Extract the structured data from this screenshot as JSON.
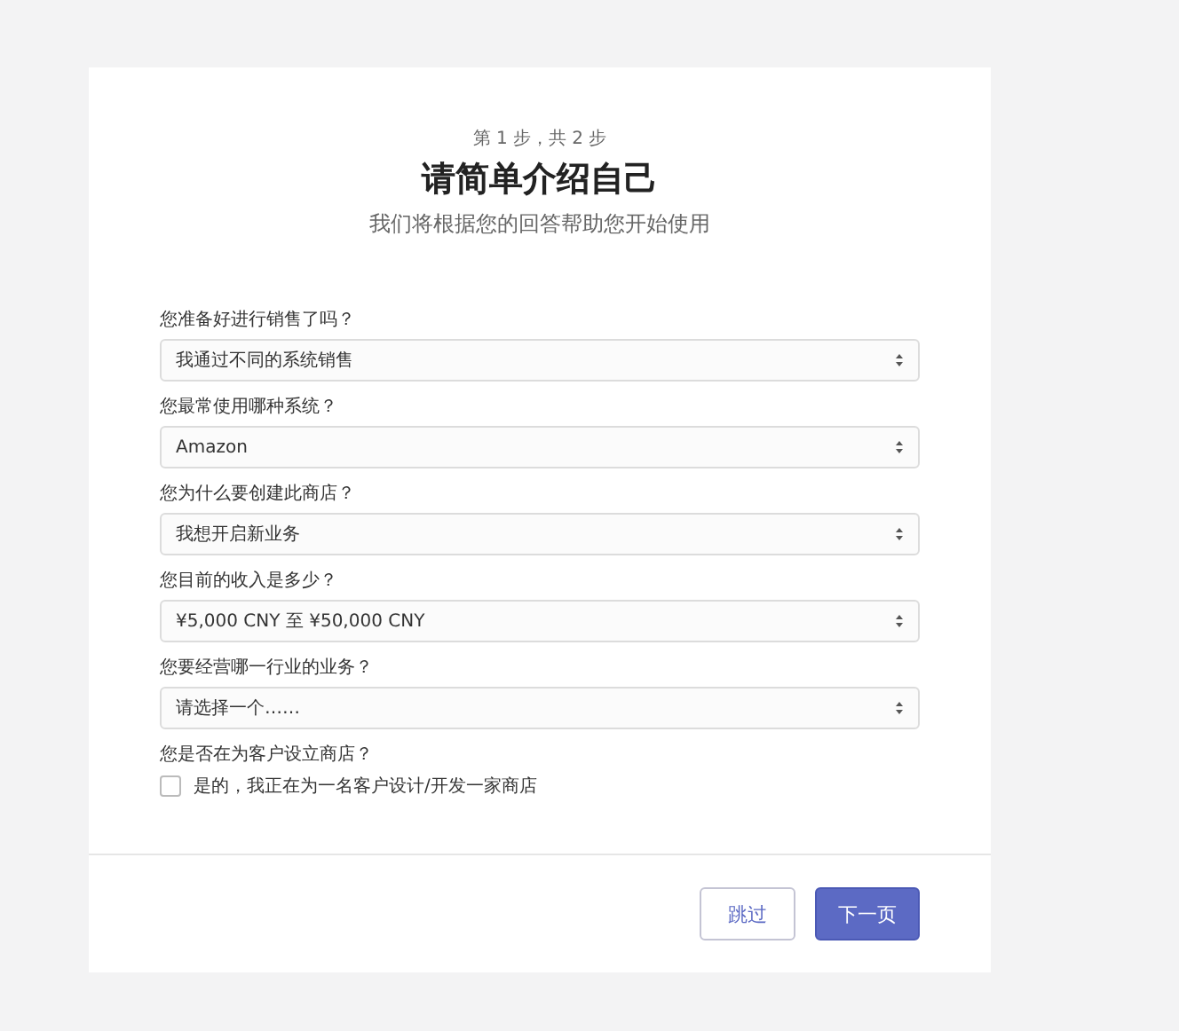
{
  "header": {
    "step": "第 1 步，共 2 步",
    "title": "请简单介绍自己",
    "subtitle": "我们将根据您的回答帮助您开始使用"
  },
  "questions": [
    {
      "kind": "select",
      "label": "您准备好进行销售了吗？",
      "value": "我通过不同的系统销售"
    },
    {
      "kind": "select",
      "label": "您最常使用哪种系统？",
      "value": "Amazon"
    },
    {
      "kind": "select",
      "label": "您为什么要创建此商店？",
      "value": "我想开启新业务"
    },
    {
      "kind": "select",
      "label": "您目前的收入是多少？",
      "value": "¥5,000 CNY 至 ¥50,000 CNY"
    },
    {
      "kind": "select",
      "label": "您要经营哪一行业的业务？",
      "value": "请选择一个……"
    },
    {
      "kind": "checkbox",
      "label": "您是否在为客户设立商店？",
      "option": "是的，我正在为一名客户设计/开发一家商店",
      "checked": false
    }
  ],
  "buttons": [
    {
      "label": "跳过",
      "kind": "secondary"
    },
    {
      "label": "下一页",
      "kind": "primary"
    }
  ]
}
